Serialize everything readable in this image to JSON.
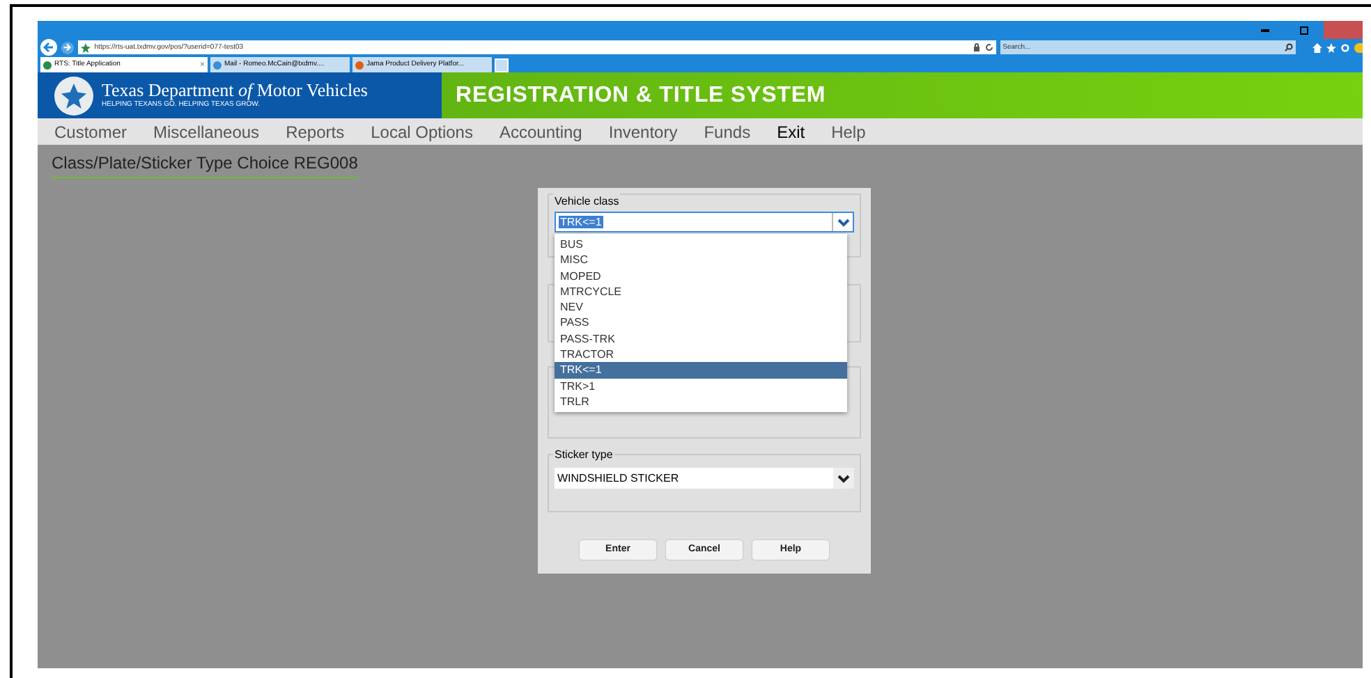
{
  "browser": {
    "url": "https://rts-uat.txdmv.gov/pos/?userid=077-test03",
    "search_placeholder": "Search...",
    "tabs": [
      {
        "label": "RTS: Title Application",
        "selected": true,
        "close": "×"
      },
      {
        "label": "Mail - Romeo.McCain@txdmv....",
        "selected": false
      },
      {
        "label": "Jama Product Delivery Platfor...",
        "selected": false
      }
    ]
  },
  "header": {
    "agency": "Texas Department *of* Motor Vehicles",
    "tagline": "HELPING TEXANS GO. HELPING TEXAS GROW.",
    "system_title": "REGISTRATION & TITLE SYSTEM"
  },
  "menu": [
    {
      "label": "Customer",
      "selected": false
    },
    {
      "label": "Miscellaneous",
      "selected": false
    },
    {
      "label": "Reports",
      "selected": false
    },
    {
      "label": "Local Options",
      "selected": false
    },
    {
      "label": "Accounting",
      "selected": false
    },
    {
      "label": "Inventory",
      "selected": false
    },
    {
      "label": "Funds",
      "selected": false
    },
    {
      "label": "Exit",
      "selected": true
    },
    {
      "label": "Help",
      "selected": false
    }
  ],
  "page_title": "Class/Plate/Sticker Type Choice REG008",
  "dialog": {
    "vehicle_class": {
      "label": "Vehicle class",
      "value": "TRK<=1",
      "expanded": true,
      "options": [
        {
          "label": "BUS",
          "selected": false
        },
        {
          "label": "MISC",
          "selected": false
        },
        {
          "label": "MOPED",
          "selected": false
        },
        {
          "label": "MTRCYCLE",
          "selected": false
        },
        {
          "label": "NEV",
          "selected": false
        },
        {
          "label": "PASS",
          "selected": false
        },
        {
          "label": "PASS-TRK",
          "selected": false
        },
        {
          "label": "TRACTOR",
          "selected": false
        },
        {
          "label": "TRK<=1",
          "selected": true
        },
        {
          "label": "TRK>1",
          "selected": false
        },
        {
          "label": "TRLR",
          "selected": false
        }
      ]
    },
    "sticker_type": {
      "label": "Sticker type",
      "value": "WINDSHIELD STICKER"
    },
    "buttons": [
      "Enter",
      "Cancel",
      "Help"
    ]
  }
}
